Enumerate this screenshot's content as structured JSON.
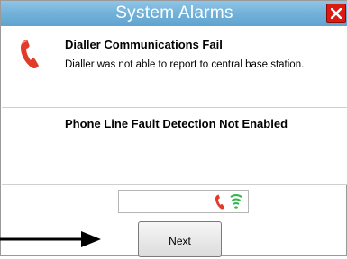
{
  "window": {
    "title": "System Alarms"
  },
  "alarms": [
    {
      "title": "Dialler Communications Fail",
      "description": "Dialler was not able to report to central base station.",
      "icon": "phone-red-icon"
    },
    {
      "title": "Phone Line Fault Detection Not Enabled",
      "description": ""
    }
  ],
  "status": {
    "icons": [
      "phone-red-icon",
      "signal-green-icon"
    ]
  },
  "buttons": {
    "next_label": "Next"
  },
  "colors": {
    "titlebar": "#72b1d9",
    "close": "#dd1a12",
    "phone": "#e23b2a",
    "signal": "#2fb84a"
  }
}
